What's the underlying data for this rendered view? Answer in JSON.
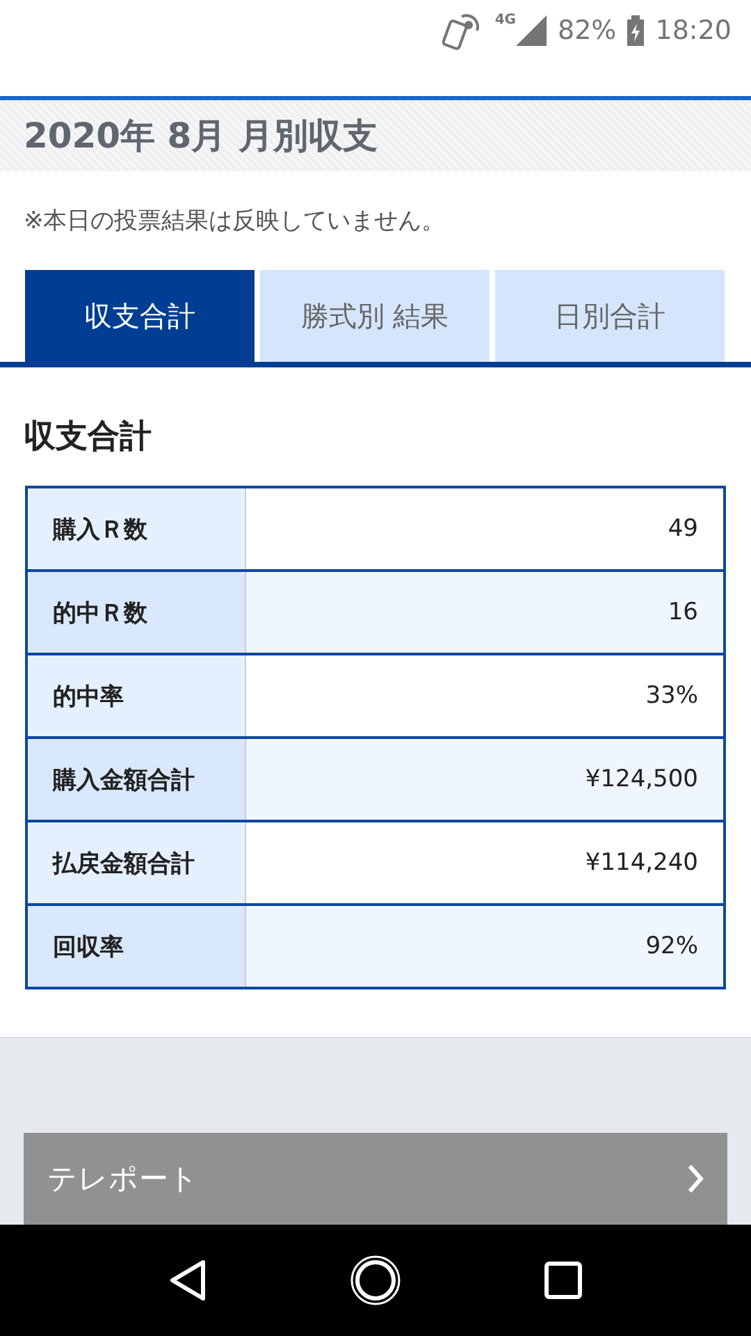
{
  "status_bar": {
    "network": "4G",
    "battery": "82%",
    "time": "18:20"
  },
  "header": {
    "title": "2020年 8月 月別収支"
  },
  "note": "※本日の投票結果は反映していません。",
  "tabs": [
    {
      "label": "収支合計",
      "selected": true
    },
    {
      "label": "勝式別 結果",
      "selected": false
    },
    {
      "label": "日別合計",
      "selected": false
    }
  ],
  "section_title": "収支合計",
  "table": {
    "rows": [
      {
        "label": "購入Ｒ数",
        "value": "49"
      },
      {
        "label": "的中Ｒ数",
        "value": "16"
      },
      {
        "label": "的中率",
        "value": "33%"
      },
      {
        "label": "購入金額合計",
        "value": "¥124,500"
      },
      {
        "label": "払戻金額合計",
        "value": "¥114,240"
      },
      {
        "label": "回収率",
        "value": "92%"
      }
    ]
  },
  "link_button": {
    "label": "テレポート"
  }
}
